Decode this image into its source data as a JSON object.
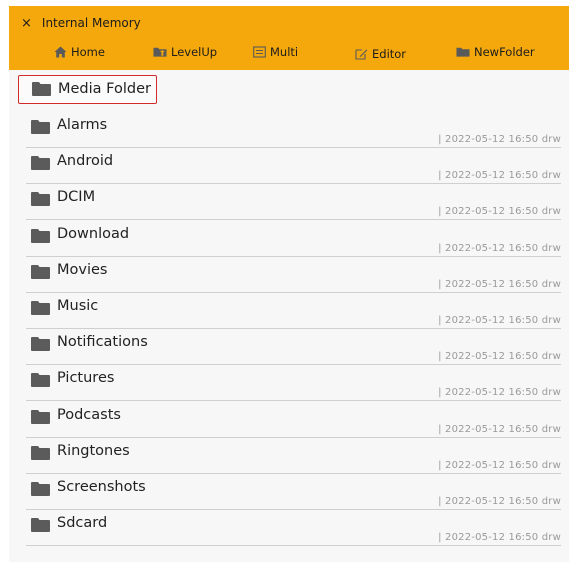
{
  "header": {
    "close_glyph": "×",
    "title": "Internal Memory"
  },
  "toolbar": {
    "home": "Home",
    "levelup": "LevelUp",
    "multi": "Multi",
    "editor": "Editor",
    "newfolder": "NewFolder"
  },
  "current_folder": "Media Folder",
  "folders": [
    {
      "name": "Alarms",
      "meta": "| 2022-05-12  16:50  drw"
    },
    {
      "name": "Android",
      "meta": "| 2022-05-12  16:50  drw"
    },
    {
      "name": "DCIM",
      "meta": "| 2022-05-12  16:50  drw"
    },
    {
      "name": "Download",
      "meta": "| 2022-05-12  16:50  drw"
    },
    {
      "name": "Movies",
      "meta": "| 2022-05-12  16:50  drw"
    },
    {
      "name": "Music",
      "meta": "| 2022-05-12  16:50  drw"
    },
    {
      "name": "Notifications",
      "meta": "| 2022-05-12  16:50  drw"
    },
    {
      "name": "Pictures",
      "meta": "| 2022-05-12  16:50  drw"
    },
    {
      "name": "Podcasts",
      "meta": "| 2022-05-12  16:50  drw"
    },
    {
      "name": "Ringtones",
      "meta": "| 2022-05-12  16:50  drw"
    },
    {
      "name": "Screenshots",
      "meta": "| 2022-05-12  16:50  drw"
    },
    {
      "name": "Sdcard",
      "meta": "| 2022-05-12  16:50  drw"
    }
  ],
  "colors": {
    "header_bg": "#f5a80b",
    "selection_border": "#d32a2a",
    "folder_icon": "#5b5b5b"
  },
  "icons": {
    "home": "home-icon",
    "levelup": "level-up-icon",
    "multi": "multi-select-icon",
    "editor": "editor-icon",
    "newfolder": "new-folder-icon",
    "folder": "folder-icon"
  }
}
